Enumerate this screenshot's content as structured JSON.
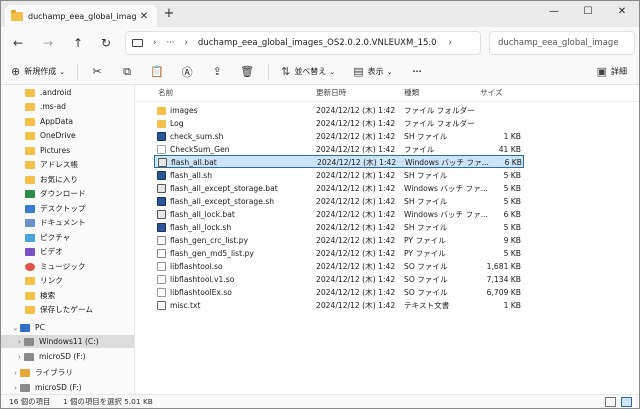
{
  "tab": {
    "title": "duchamp_eea_global_images_"
  },
  "window_controls": {
    "minimize": "—",
    "maximize": "☐",
    "close": "✕"
  },
  "nav": {
    "back": "←",
    "forward": "→",
    "up": "↑",
    "refresh": "↻"
  },
  "address": {
    "sep1": "›",
    "ellipsis": "···",
    "sep2": "›",
    "path": "duchamp_eea_global_images_OS2.0.2.0.VNLEUXM_15.0",
    "sep3": "›"
  },
  "search": {
    "placeholder": "duchamp_eea_global_image"
  },
  "toolbar": {
    "new_label": "新規作成",
    "sort_label": "並べ替え",
    "view_label": "表示",
    "more_label": "···",
    "details_label": "詳細"
  },
  "sidebar": {
    "items": [
      {
        "label": ".android",
        "icon": "folder"
      },
      {
        "label": ".ms-ad",
        "icon": "folder"
      },
      {
        "label": "AppData",
        "icon": "folder"
      },
      {
        "label": "OneDrive",
        "icon": "folder"
      },
      {
        "label": "Pictures",
        "icon": "folder"
      },
      {
        "label": "アドレス帳",
        "icon": "folder"
      },
      {
        "label": "お気に入り",
        "icon": "folder"
      },
      {
        "label": "ダウンロード",
        "icon": "dl"
      },
      {
        "label": "デスクトップ",
        "icon": "blue"
      },
      {
        "label": "ドキュメント",
        "icon": "doc"
      },
      {
        "label": "ピクチャ",
        "icon": "pic"
      },
      {
        "label": "ビデオ",
        "icon": "vid"
      },
      {
        "label": "ミュージック",
        "icon": "mus"
      },
      {
        "label": "リンク",
        "icon": "folder"
      },
      {
        "label": "検索",
        "icon": "folder"
      },
      {
        "label": "保存したゲーム",
        "icon": "folder"
      },
      {
        "label": "PC",
        "icon": "pc"
      },
      {
        "label": "Windows11 (C:)",
        "icon": "drive"
      },
      {
        "label": "microSD (F:)",
        "icon": "drive"
      },
      {
        "label": "ライブラリ",
        "icon": "lib"
      },
      {
        "label": "microSD (F:)",
        "icon": "drive"
      }
    ]
  },
  "columns": {
    "name": "名前",
    "date": "更新日時",
    "type": "種類",
    "size": "サイズ"
  },
  "files": [
    {
      "name": "images",
      "date": "2024/12/12 (木) 1:42",
      "type": "ファイル フォルダー",
      "size": "",
      "icon": "folder"
    },
    {
      "name": "Log",
      "date": "2024/12/12 (木) 1:42",
      "type": "ファイル フォルダー",
      "size": "",
      "icon": "folder"
    },
    {
      "name": "check_sum.sh",
      "date": "2024/12/12 (木) 1:42",
      "type": "SH ファイル",
      "size": "1 KB",
      "icon": "sh"
    },
    {
      "name": "CheckSum_Gen",
      "date": "2024/12/12 (木) 1:42",
      "type": "ファイル",
      "size": "41 KB",
      "icon": "file"
    },
    {
      "name": "flash_all.bat",
      "date": "2024/12/12 (木) 1:42",
      "type": "Windows バッチ ファ...",
      "size": "6 KB",
      "icon": "bat"
    },
    {
      "name": "flash_all.sh",
      "date": "2024/12/12 (木) 1:42",
      "type": "SH ファイル",
      "size": "5 KB",
      "icon": "sh"
    },
    {
      "name": "flash_all_except_storage.bat",
      "date": "2024/12/12 (木) 1:42",
      "type": "Windows バッチ ファ...",
      "size": "5 KB",
      "icon": "bat"
    },
    {
      "name": "flash_all_except_storage.sh",
      "date": "2024/12/12 (木) 1:42",
      "type": "SH ファイル",
      "size": "5 KB",
      "icon": "sh"
    },
    {
      "name": "flash_all_lock.bat",
      "date": "2024/12/12 (木) 1:42",
      "type": "Windows バッチ ファ...",
      "size": "6 KB",
      "icon": "bat"
    },
    {
      "name": "flash_all_lock.sh",
      "date": "2024/12/12 (木) 1:42",
      "type": "SH ファイル",
      "size": "5 KB",
      "icon": "sh"
    },
    {
      "name": "flash_gen_crc_list.py",
      "date": "2024/12/12 (木) 1:42",
      "type": "PY ファイル",
      "size": "9 KB",
      "icon": "py"
    },
    {
      "name": "flash_gen_md5_list.py",
      "date": "2024/12/12 (木) 1:42",
      "type": "PY ファイル",
      "size": "5 KB",
      "icon": "py"
    },
    {
      "name": "libflashtool.so",
      "date": "2024/12/12 (木) 1:42",
      "type": "SO ファイル",
      "size": "1,681 KB",
      "icon": "so"
    },
    {
      "name": "libflashtool.v1.so",
      "date": "2024/12/12 (木) 1:42",
      "type": "SO ファイル",
      "size": "7,134 KB",
      "icon": "so"
    },
    {
      "name": "libflashtoolEx.so",
      "date": "2024/12/12 (木) 1:42",
      "type": "SO ファイル",
      "size": "6,709 KB",
      "icon": "so"
    },
    {
      "name": "misc.txt",
      "date": "2024/12/12 (木) 1:42",
      "type": "テキスト文書",
      "size": "1 KB",
      "icon": "txt"
    }
  ],
  "status": {
    "count": "16 個の項目",
    "selection": "1 個の項目を選択 5.01 KB"
  }
}
